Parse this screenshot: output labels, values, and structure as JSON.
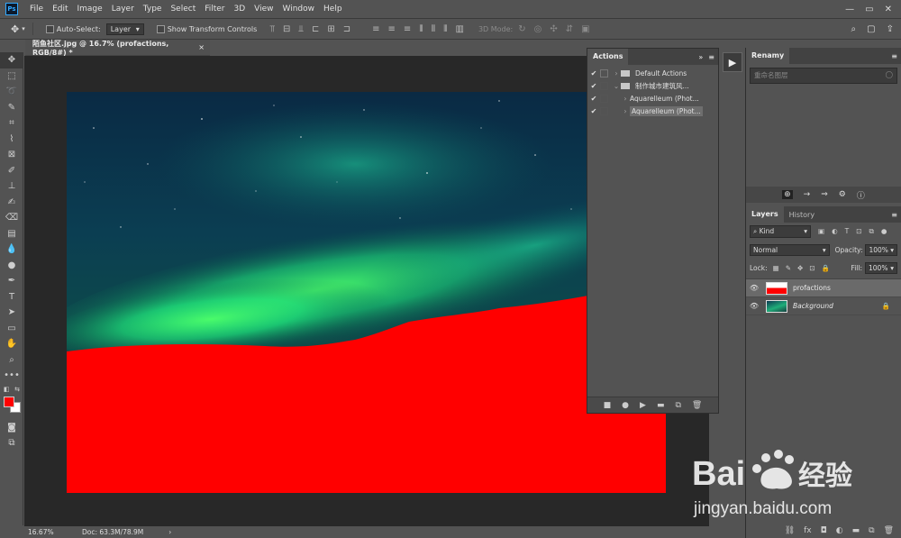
{
  "app": {
    "logo": "Ps"
  },
  "menu": [
    "File",
    "Edit",
    "Image",
    "Layer",
    "Type",
    "Select",
    "Filter",
    "3D",
    "View",
    "Window",
    "Help"
  ],
  "options": {
    "auto_select_label": "Auto-Select:",
    "auto_select_value": "Layer",
    "show_transform_label": "Show Transform Controls",
    "mode_3d_label": "3D Mode:"
  },
  "document": {
    "tab_title": "陌鱼社区.jpg @ 16.7% (profactions, RGB/8#) *",
    "close": "×"
  },
  "status": {
    "zoom": "16.67%",
    "doc": "Doc: 63.3M/78.9M",
    "arrow": "›"
  },
  "actions_panel": {
    "title": "Actions",
    "rows": [
      {
        "label": "Default Actions"
      },
      {
        "label": "制作城市建筑风..."
      },
      {
        "label": "Aquarelleum (Phot..."
      },
      {
        "label": "Aquarelleum (Phot..."
      }
    ]
  },
  "renamy_panel": {
    "title": "Renamy",
    "placeholder": "重命名图层"
  },
  "layers_panel": {
    "tabs": [
      "Layers",
      "History"
    ],
    "kind_label": "Kind",
    "blend_mode": "Normal",
    "opacity_label": "Opacity:",
    "opacity_value": "100%",
    "lock_label": "Lock:",
    "fill_label": "Fill:",
    "fill_value": "100%",
    "layers": [
      {
        "name": "profactions",
        "selected": true
      },
      {
        "name": "Background",
        "selected": false,
        "locked": true
      }
    ]
  },
  "colors": {
    "foreground": "#ff0000",
    "background": "#ffffff",
    "canvas_red": "#ff0000",
    "panel_bg": "#535353"
  },
  "watermark": {
    "brand": "Bai",
    "brand_cn": "经验",
    "url": "jingyan.baidu.com"
  }
}
